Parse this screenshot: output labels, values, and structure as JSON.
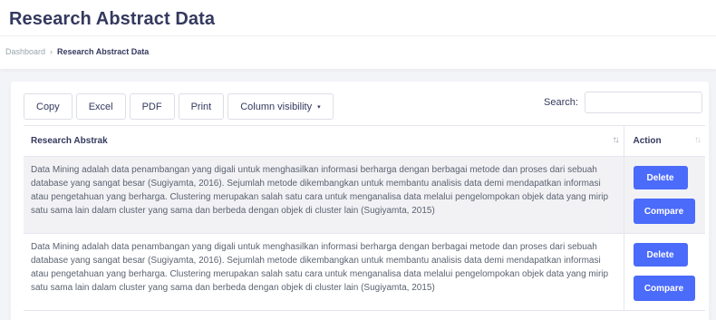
{
  "header": {
    "title": "Research Abstract Data"
  },
  "breadcrumb": {
    "items": [
      "Dashboard",
      "Research Abstract Data"
    ],
    "separator": "›"
  },
  "toolbar": {
    "buttons": [
      "Copy",
      "Excel",
      "PDF",
      "Print",
      "Column visibility"
    ],
    "column_visibility_caret": "▾"
  },
  "search": {
    "label": "Search:",
    "value": "",
    "placeholder": ""
  },
  "table": {
    "columns": [
      "Research Abstrak",
      "Action"
    ],
    "sort_icon": "↑↓",
    "rows": [
      {
        "abstract": "Data Mining adalah data penambangan yang digali untuk menghasilkan informasi berharga dengan berbagai metode dan proses dari sebuah database yang sangat besar (Sugiyamta, 2016). Sejumlah metode dikembangkan untuk membantu analisis data demi mendapatkan informasi atau pengetahuan yang berharga. Clustering merupakan salah satu cara untuk menganalisa data melalui pengelompokan objek data yang mirip satu sama lain dalam cluster yang sama dan berbeda dengan objek di cluster lain (Sugiyamta, 2015)",
        "actions": [
          "Delete",
          "Compare"
        ]
      },
      {
        "abstract": "Data Mining adalah data penambangan yang digali untuk menghasilkan informasi berharga dengan berbagai metode dan proses dari sebuah database yang sangat besar (Sugiyamta, 2016). Sejumlah metode dikembangkan untuk membantu analisis data demi mendapatkan informasi atau pengetahuan yang berharga. Clustering merupakan salah satu cara untuk menganalisa data melalui pengelompokan objek data yang mirip satu sama lain dalam cluster yang sama dan berbeda dengan objek di cluster lain (Sugiyamta, 2015)",
        "actions": [
          "Delete",
          "Compare"
        ]
      }
    ]
  },
  "colors": {
    "primary": "#4b6bfb",
    "background": "#f3f4f8",
    "text": "#34395e",
    "row_striped": "#f2f2f5"
  }
}
